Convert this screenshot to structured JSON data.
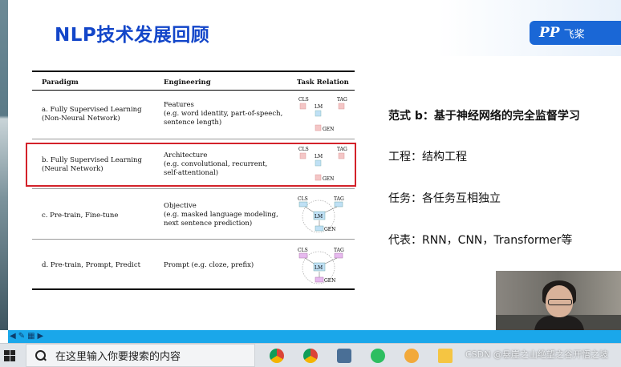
{
  "slide": {
    "title": "NLP技术发展回顾",
    "logo_mark": "PP",
    "logo_text": "飞桨"
  },
  "table": {
    "headers": {
      "paradigm": "Paradigm",
      "engineering": "Engineering",
      "relation": "Task Relation"
    },
    "rows": [
      {
        "paradigm": [
          "a. Fully Supervised Learning",
          "(Non-Neural Network)"
        ],
        "engineering": [
          "Features",
          "(e.g. word identity, part-of-speech,",
          "sentence length)"
        ]
      },
      {
        "paradigm": [
          "b. Fully Supervised Learning",
          "(Neural Network)"
        ],
        "engineering": [
          "Architecture",
          "(e.g. convolutional, recurrent,",
          "self-attentional)"
        ]
      },
      {
        "paradigm": [
          "c. Pre-train, Fine-tune"
        ],
        "engineering": [
          "Objective",
          "(e.g. masked language modeling,",
          "next sentence prediction)"
        ]
      },
      {
        "paradigm": [
          "d. Pre-train, Prompt, Predict"
        ],
        "engineering": [
          "Prompt (e.g. cloze, prefix)"
        ]
      }
    ],
    "diagram_labels": {
      "cls": "CLS",
      "tag": "TAG",
      "lm": "LM",
      "gen": "GEN"
    },
    "highlight_color": "#d3222a"
  },
  "notes": {
    "heading": "范式 b：基于神经网络的完全监督学习",
    "engineering": "工程：结构工程",
    "task": "任务：各任务互相独立",
    "representative": "代表：RNN，CNN，Transformer等"
  },
  "taskbar": {
    "search_placeholder": "在这里输入你要搜索的内容",
    "apps": [
      "chrome-icon",
      "chrome-icon",
      "calculator-icon",
      "evernote-icon",
      "game-icon",
      "folder-icon",
      "mail-icon",
      "photos-icon",
      "app-icon"
    ]
  },
  "watermark": "CSDN @悬崖之山绝望之谷开悟之坡",
  "colors": {
    "title": "#1346c9",
    "brand": "#1a67d6",
    "slide_bar": "#1aa7ea"
  }
}
